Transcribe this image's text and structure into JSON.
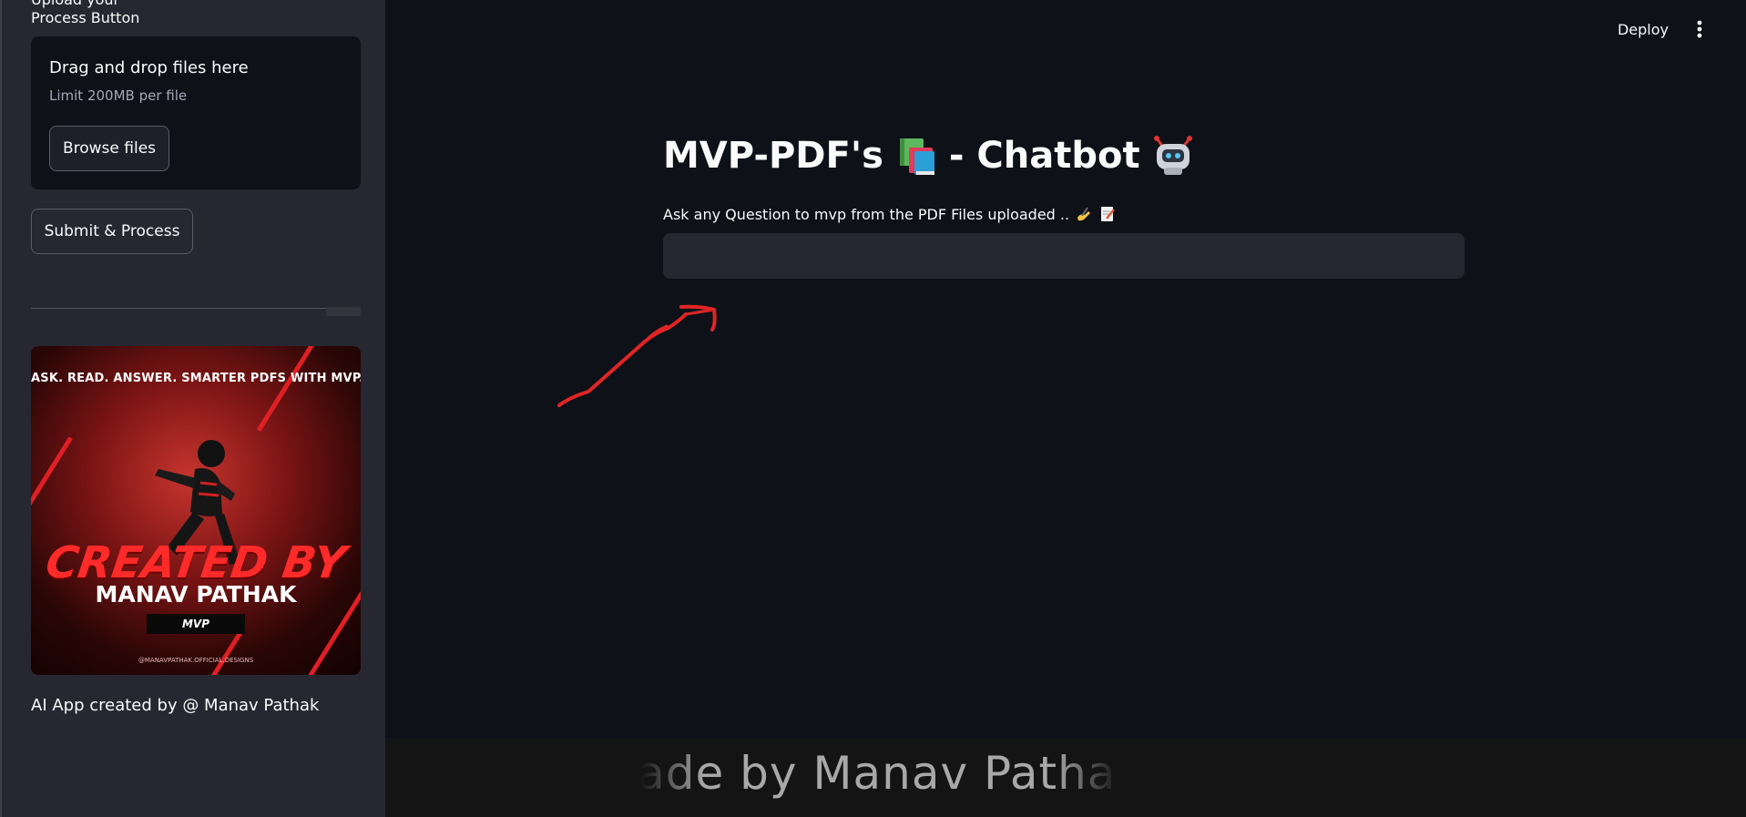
{
  "sidebar": {
    "clipped_label": "Upload your",
    "process_label": "Process Button",
    "dropzone": {
      "title": "Drag and drop files here",
      "limit": "Limit 200MB per file",
      "browse_label": "Browse files"
    },
    "submit_label": "Submit & Process",
    "poster": {
      "tagline": "ASK. READ. ANSWER. SMARTER PDFS WITH MVP.",
      "created_by": "CREATED BY",
      "name": "MANAV PATHAK",
      "badge": "MVP",
      "handle": "@MANAVPATHAK.OFFICIAL.DESIGNS"
    },
    "credit": "AI App created by @ Manav Pathak"
  },
  "header": {
    "deploy_label": "Deploy",
    "menu_icon": "kebab-vertical-icon"
  },
  "main": {
    "title_part1": "MVP-PDF's",
    "title_part2": "- Chatbot",
    "title_icons": [
      "books-emoji-icon",
      "robot-emoji-icon"
    ],
    "prompt_label": "Ask any Question to mvp from the PDF Files uploaded ..",
    "prompt_icons": [
      "writing-hand-emoji-icon",
      "memo-emoji-icon"
    ],
    "question_value": "",
    "arrow_color": "#e02525"
  },
  "footer": {
    "marquee_text": "Made by Manav Pathak ."
  },
  "colors": {
    "background": "#0e1117",
    "sidebar": "#262730",
    "input": "#262730",
    "accent_red": "#e01f25",
    "text": "#fafafa"
  }
}
